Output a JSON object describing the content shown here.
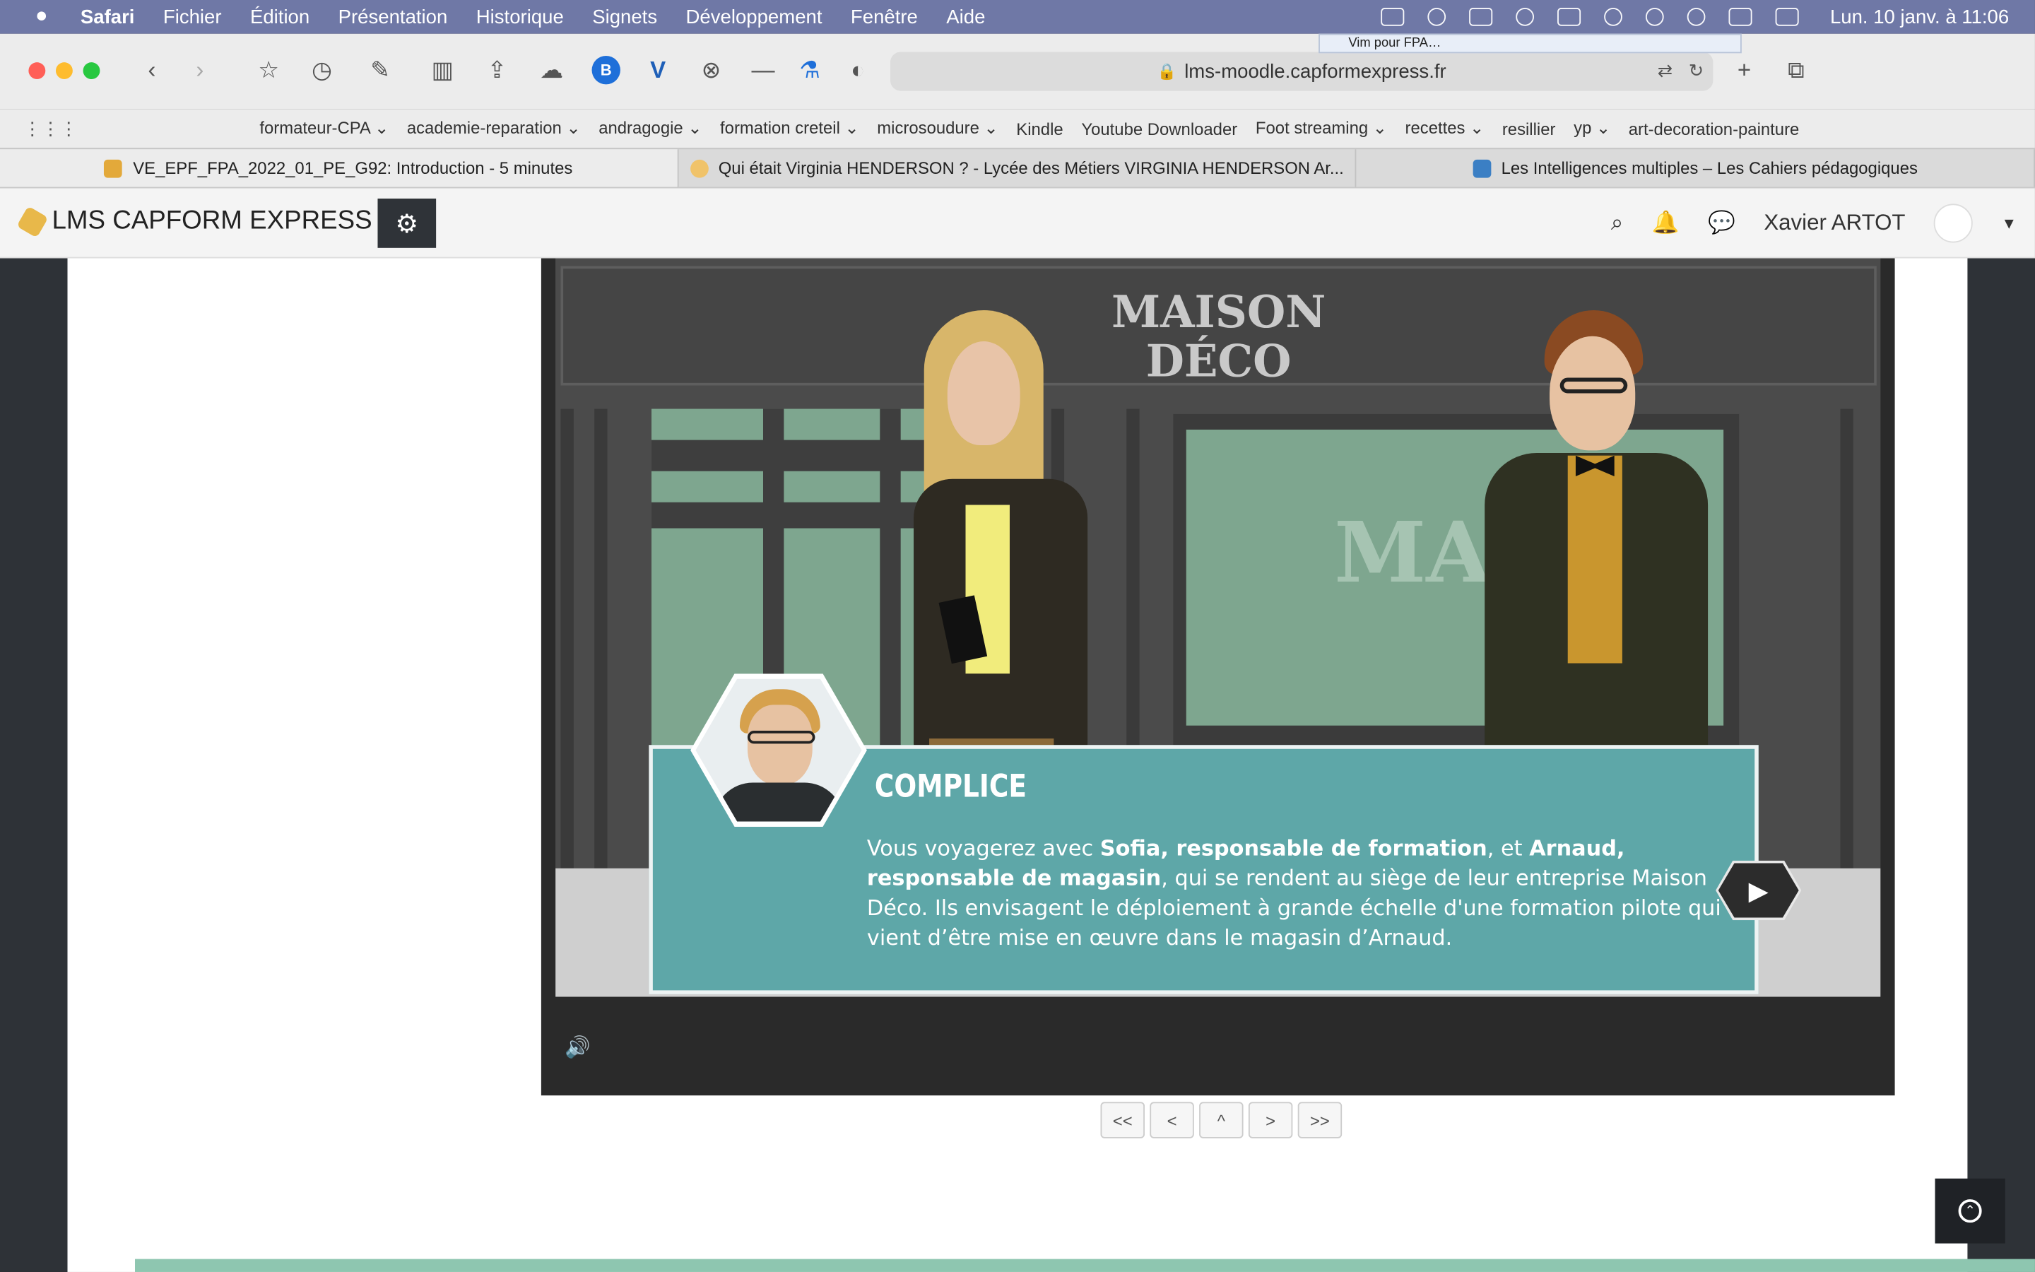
{
  "menubar": {
    "app": "Safari",
    "items": [
      "Fichier",
      "Édition",
      "Présentation",
      "Historique",
      "Signets",
      "Développement",
      "Fenêtre",
      "Aide"
    ],
    "clock": "Lun. 10 janv. à  11:06",
    "tooltip": "Vim pour FPA…"
  },
  "toolbar": {
    "url": "lms-moodle.capformexpress.fr"
  },
  "bookmarks": [
    "formateur-CPA ⌄",
    "academie-reparation ⌄",
    "andragogie ⌄",
    "formation creteil ⌄",
    "microsoudure ⌄",
    "Kindle",
    "Youtube Downloader",
    "Foot streaming ⌄",
    "recettes ⌄",
    "resillier",
    "yp ⌄",
    "art-decoration-painture"
  ],
  "tabs": [
    {
      "title": "VE_EPF_FPA_2022_01_PE_G92: Introduction - 5 minutes",
      "color": "#e3a93a"
    },
    {
      "title": "Qui était Virginia HENDERSON ? - Lycée des Métiers VIRGINIA HENDERSON Ar...",
      "color": "#f0c36a"
    },
    {
      "title": "Les Intelligences multiples – Les Cahiers pédagogiques",
      "color": "#3b7fc4"
    }
  ],
  "lms": {
    "brand": "LMS CAPFORM EXPRESS",
    "user": "Xavier ARTOT"
  },
  "scene": {
    "sign_line1": "MAISON",
    "sign_line2": "DÉCO",
    "speaker": "COMPLICE",
    "text_1": "Vous voyagerez avec ",
    "bold_1": "Sofia, responsable de formation",
    "text_2": ", et ",
    "bold_2": "Arnaud, responsable de magasin",
    "text_3": ", qui se rendent au siège de leur entreprise Maison Déco. Ils envisagent le déploiement à grande échelle d'une formation pilote qui vient d’être mise en œuvre dans le magasin d’Arnaud."
  },
  "nav": [
    "<<",
    "<",
    "^",
    ">",
    ">>"
  ],
  "colors": {
    "menubar": "#6f78a6",
    "dialog": "#5ea7a8",
    "window_green": "#7ea68f"
  }
}
